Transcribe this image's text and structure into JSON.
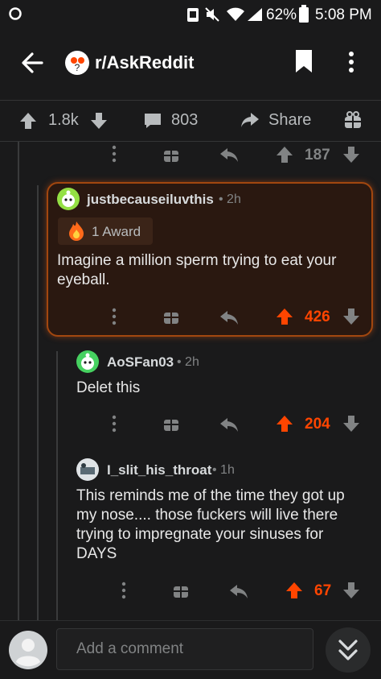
{
  "status_bar": {
    "battery": "62%",
    "time": "5:08 PM"
  },
  "header": {
    "subreddit": "r/AskReddit"
  },
  "post_actions": {
    "upvotes": "1.8k",
    "comments": "803",
    "share_label": "Share"
  },
  "top_stub": {
    "score": "187"
  },
  "comments": [
    {
      "username": "justbecauseiluvthis",
      "age": "2h",
      "award_label": "1 Award",
      "body": "Imagine a million sperm trying to eat your eyeball.",
      "score": "426"
    },
    {
      "username": "AoSFan03",
      "age": "2h",
      "body": "Delet this",
      "score": "204"
    },
    {
      "username": "I_slit_his_throat",
      "age": "1h",
      "body": "This reminds me of the time they got up my nose.... those fuckers will live there trying to impregnate your sinuses for DAYS",
      "score": "67"
    }
  ],
  "footer": {
    "comment_placeholder": "Add a comment"
  },
  "colors": {
    "upvote_orange": "#ff4500",
    "background": "#1a1a1b",
    "highlight_border": "#a2470f"
  }
}
